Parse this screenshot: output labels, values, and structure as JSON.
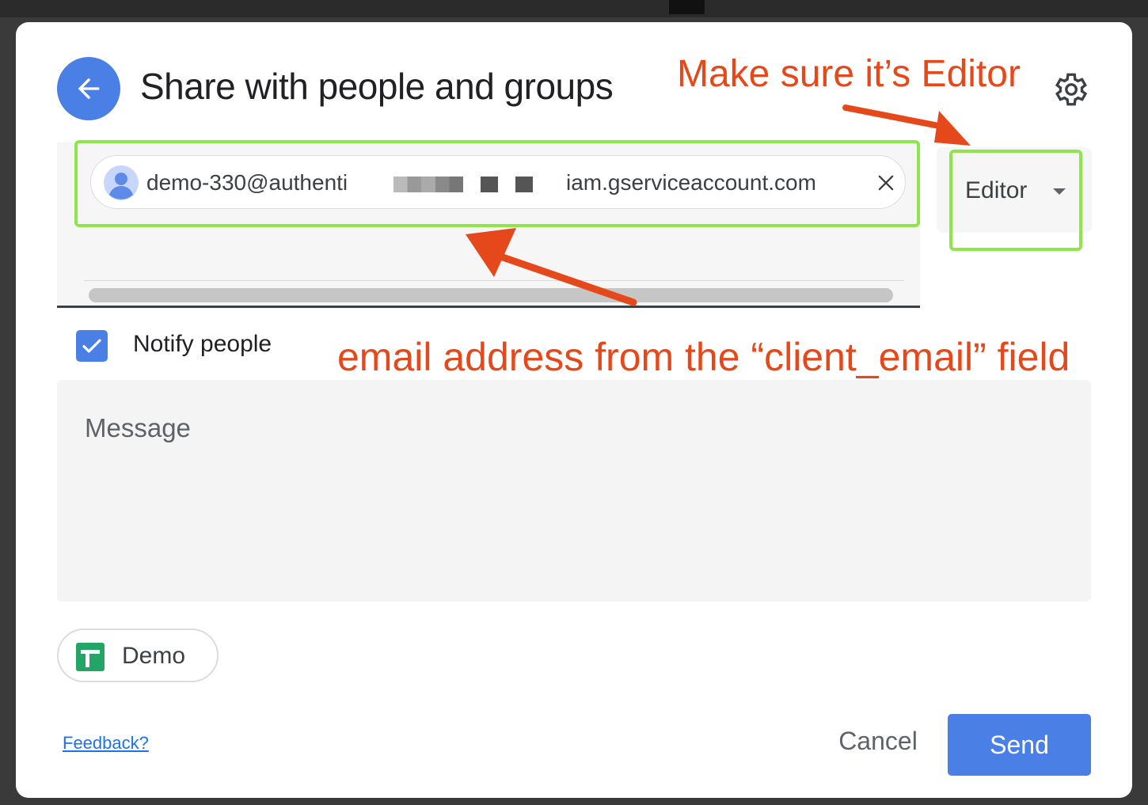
{
  "dialog": {
    "title": "Share with people and groups",
    "accent_color": "#4a7fe6"
  },
  "annotations": {
    "editor_note": "Make sure it’s Editor",
    "email_note": "email address from the “client_email” field",
    "color": "#e4481b",
    "highlight_color": "#8ee64a"
  },
  "recipient": {
    "email_start": "demo-330@authenti",
    "email_end": "iam.gserviceaccount.com",
    "role": "Editor"
  },
  "notify": {
    "label": "Notify people",
    "checked": true
  },
  "message": {
    "placeholder": "Message"
  },
  "file_chip": {
    "label": "Demo"
  },
  "footer": {
    "feedback": "Feedback?",
    "cancel": "Cancel",
    "send": "Send"
  }
}
